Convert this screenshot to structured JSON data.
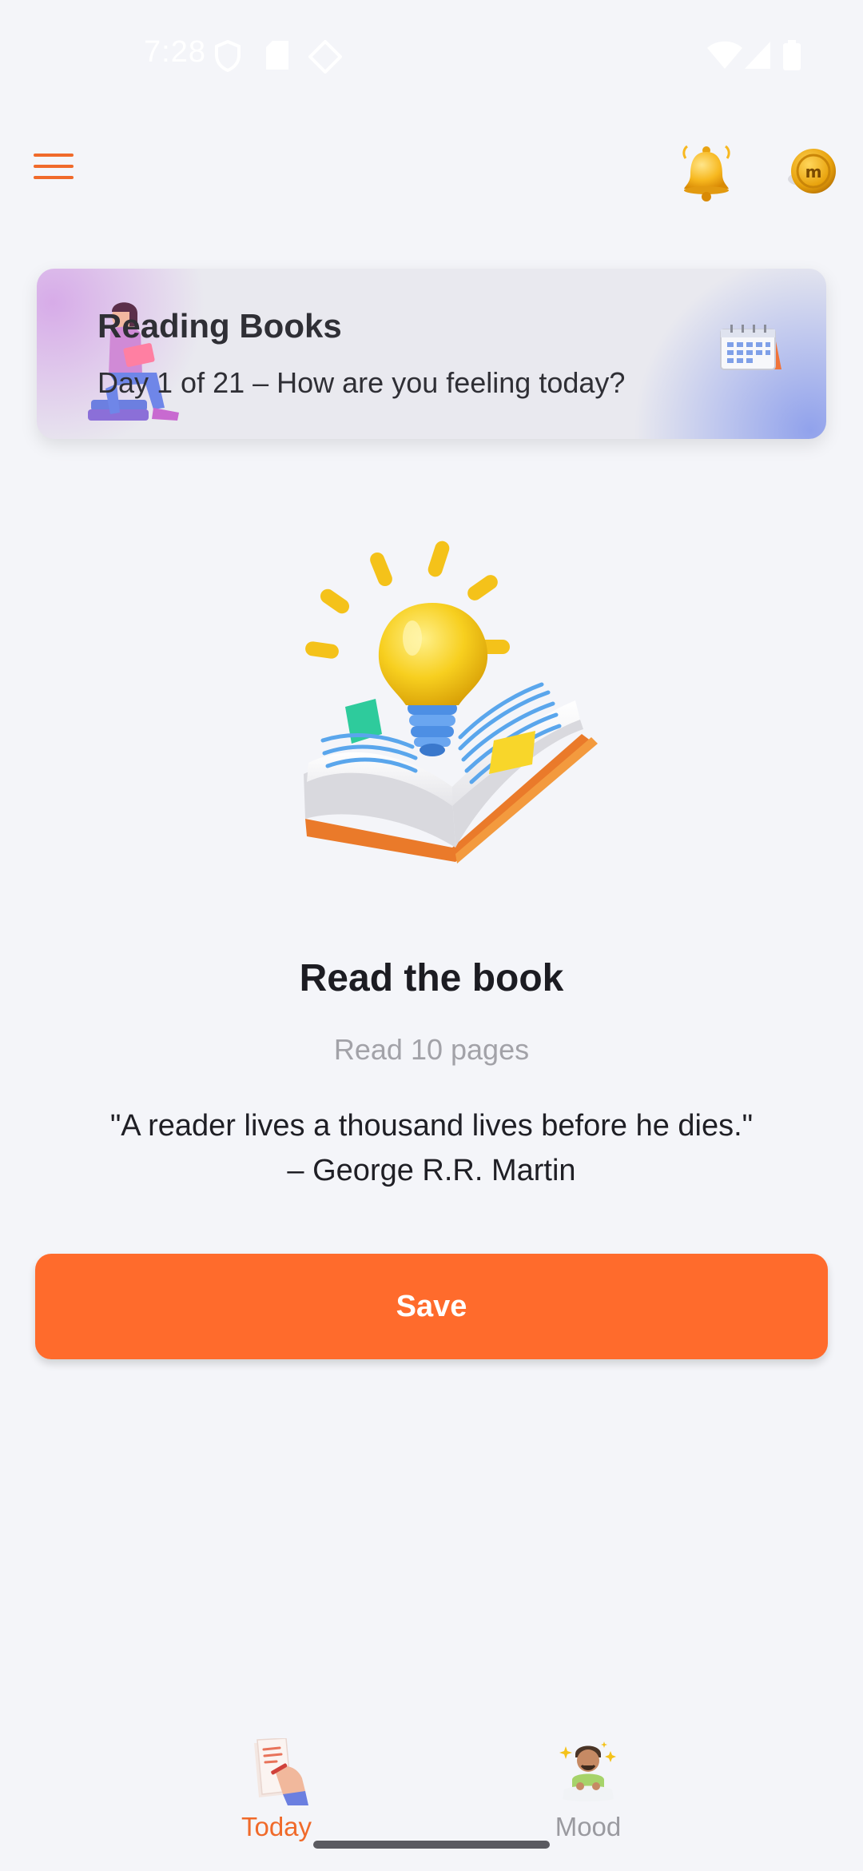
{
  "status_bar": {
    "time": "7:28",
    "icons": [
      "shield-icon",
      "sd-card-icon",
      "location-diamond-icon",
      "wifi-icon",
      "signal-icon",
      "battery-icon"
    ]
  },
  "app_bar": {
    "menu_icon": "hamburger-menu-icon",
    "notification_icon": "bell-icon",
    "coin_icon": "coin-icon",
    "accent_color": "#ff6b2c"
  },
  "banner": {
    "title": "Reading Books",
    "subtitle": "Day 1 of 21 – How are you feeling today?"
  },
  "task": {
    "title": "Read the book",
    "subtitle": "Read 10 pages",
    "quote_line1": "\"A reader lives a thousand lives before he dies.\"",
    "quote_line2": "– George R.R. Martin"
  },
  "actions": {
    "save_label": "Save"
  },
  "bottom_nav": {
    "items": [
      {
        "label": "Today",
        "icon": "today-journal-icon",
        "active": true
      },
      {
        "label": "Mood",
        "icon": "mood-meditation-icon",
        "active": false
      }
    ]
  }
}
